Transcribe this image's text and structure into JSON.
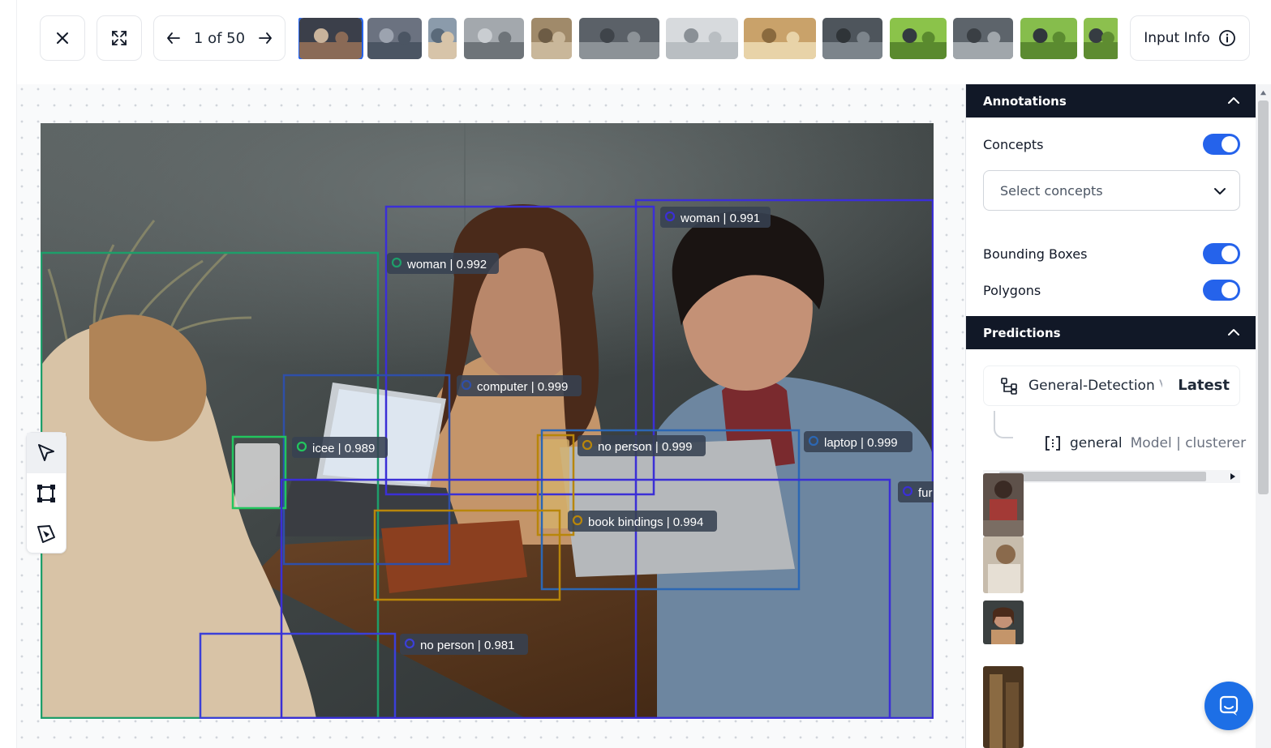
{
  "topbar": {
    "counter": "1 of 50",
    "input_info_label": "Input Info",
    "thumbnails": [
      {
        "scene": "cafe-group",
        "colors": [
          "#3b3f4a",
          "#8a6a56",
          "#c9b39b"
        ],
        "active": true
      },
      {
        "scene": "crowd-street",
        "colors": [
          "#6b7280",
          "#4b5563",
          "#9ca3af"
        ]
      },
      {
        "scene": "group-selfie",
        "colors": [
          "#8b9bab",
          "#d7c4a9",
          "#5a6a7a"
        ]
      },
      {
        "scene": "city-street",
        "colors": [
          "#a3a8ad",
          "#6e7479",
          "#c9cdd1"
        ]
      },
      {
        "scene": "restaurant",
        "colors": [
          "#a08a6a",
          "#c9b79a",
          "#6d5c45"
        ]
      },
      {
        "scene": "traffic",
        "colors": [
          "#5b6168",
          "#8c9297",
          "#3f444a"
        ]
      },
      {
        "scene": "snow-crowd",
        "colors": [
          "#d7dadd",
          "#b9bec2",
          "#8a9096"
        ]
      },
      {
        "scene": "glass-drink",
        "colors": [
          "#c9a26a",
          "#e8d3a8",
          "#8a6a3e"
        ]
      },
      {
        "scene": "crowd-dark",
        "colors": [
          "#4e555c",
          "#7c848b",
          "#2f3438"
        ]
      },
      {
        "scene": "dog-grass",
        "colors": [
          "#8bc34a",
          "#5a8a2e",
          "#333a40"
        ]
      },
      {
        "scene": "wedding-crowd",
        "colors": [
          "#5d646b",
          "#a0a6ab",
          "#3a3f44"
        ]
      },
      {
        "scene": "dog-grass",
        "colors": [
          "#86bd4c",
          "#5b8b30",
          "#30363c"
        ]
      },
      {
        "scene": "dog-grass",
        "colors": [
          "#8cc04e",
          "#5e8c31",
          "#363c42"
        ]
      }
    ]
  },
  "annotations_panel": {
    "title": "Annotations",
    "concepts_label": "Concepts",
    "concepts_on": true,
    "select_placeholder": "Select concepts",
    "bounding_boxes_label": "Bounding Boxes",
    "bounding_boxes_on": true,
    "polygons_label": "Polygons",
    "polygons_on": true
  },
  "predictions_panel": {
    "title": "Predictions",
    "model_name": "General-Detection",
    "model_name_trailing": "V",
    "model_version": "Latest",
    "sub_model_name": "general",
    "sub_model_type": "Model | clusterer"
  },
  "detections": [
    {
      "label": "woman | 0.992",
      "color": "#1e9e6a"
    },
    {
      "label": "woman | 0.991",
      "color": "#3b2fd6"
    },
    {
      "label": "computer | 0.999",
      "color": "#2f4fa8"
    },
    {
      "label": "icee | 0.989",
      "color": "#22c55e"
    },
    {
      "label": "no person | 0.999",
      "color": "#b8860b"
    },
    {
      "label": "laptop | 0.999",
      "color": "#2c67b3"
    },
    {
      "label": "book bindings | 0.994",
      "color": "#b8860b"
    },
    {
      "label": "no person | 0.981",
      "color": "#3b3fd8"
    },
    {
      "label": "fur",
      "color": "#3b2fd6"
    }
  ],
  "colors": {
    "accent": "#2563eb",
    "panel_header": "#111827",
    "chat": "#1d6fe6"
  },
  "icons": [
    "close-icon",
    "expand-icon",
    "arrow-left-icon",
    "arrow-right-icon",
    "info-icon",
    "pointer-icon",
    "bounding-box-icon",
    "polygon-pen-icon",
    "chevron-up-icon",
    "chevron-down-icon",
    "workflow-icon",
    "model-icon",
    "chat-icon"
  ]
}
